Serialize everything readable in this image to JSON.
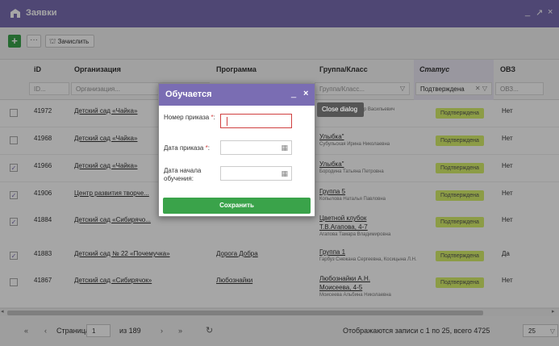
{
  "window": {
    "title": "Заявки",
    "icon": "building-icon",
    "controls": [
      "_",
      "↗",
      "×"
    ]
  },
  "toolbar": {
    "add_label": "+",
    "more_label": "···",
    "enroll_label": "Зачислить",
    "enroll_icon": "school-icon"
  },
  "columns": {
    "id": "iD",
    "org": "Организация",
    "program": "Программа",
    "group": "Группа/Класс",
    "status": "Статус",
    "ovz": "ОВЗ"
  },
  "filters": {
    "id": "ID...",
    "org": "Организация...",
    "group": "Группа/Класс...",
    "status": "Подтверждена",
    "ovz": "ОВЗ..."
  },
  "rows": [
    {
      "checked": false,
      "id": "41972",
      "org": "Детский сад «Чайка»",
      "program": "",
      "group": "",
      "group_sub": "Бадмаева Владимир Васильевич",
      "status": "Подтверждена",
      "ovz": "Нет"
    },
    {
      "checked": false,
      "id": "41968",
      "org": "Детский сад «Чайка»",
      "program": "",
      "group": "Улыбка\"",
      "group_sub": "Субульская Ирина Николаевна",
      "status": "Подтверждена",
      "ovz": "Нет"
    },
    {
      "checked": true,
      "id": "41966",
      "org": "Детский сад «Чайка»",
      "program": "",
      "group": "Улыбка\"",
      "group_sub": "Бородина Татьяна Петровна",
      "status": "Подтверждена",
      "ovz": "Нет"
    },
    {
      "checked": true,
      "id": "41906",
      "org": "Центр развития творче...",
      "program": "",
      "group": "Группа 5",
      "group_sub": "Копылова Наталья Павловна",
      "status": "Подтверждена",
      "ovz": "Нет"
    },
    {
      "checked": true,
      "id": "41884",
      "org": "Детский сад «Сибирячо...",
      "program": "",
      "group": "Цветной клубок",
      "group2": "Т.В.Агапова, 4-7",
      "group_sub": "Агапова Тамара Владимировна",
      "status": "Подтверждена",
      "ovz": "Нет"
    },
    {
      "checked": true,
      "id": "41883",
      "org": "Детский сад № 22 «Почемучка»",
      "program": "Дорога Добра",
      "group": "Группа 1",
      "group_sub": "Гарбуз Снежана Сергеевна, Косицына Л.Н.",
      "status": "Подтверждена",
      "ovz": "Да"
    },
    {
      "checked": false,
      "id": "41867",
      "org": "Детский сад «Сибирячок»",
      "program": "Любознайки",
      "group": "Любознайки А.Н.",
      "group2": "Моисеева, 4-5",
      "group_sub": "Моисеева Альбина Николаевна",
      "status": "Подтверждена",
      "ovz": "Нет"
    }
  ],
  "pager": {
    "first": "«",
    "prev": "‹",
    "page_label": "Страница",
    "page_value": "1",
    "of_label": "из 189",
    "next": "›",
    "last": "»",
    "refresh": "↻",
    "summary": "Отображаются записи с 1 по 25, всего 4725",
    "page_size": "25"
  },
  "dialog": {
    "title": "Обучается",
    "minimize": "_",
    "close": "×",
    "field1_label": "Номер приказа",
    "field2_label": "Дата приказа",
    "field3_label": "Дата начала обучения:",
    "required_mark": "*",
    "colon": ":",
    "save_label": "Сохранить"
  },
  "tooltip": {
    "text": "Close dialog"
  },
  "colors": {
    "accent": "#7a6db3",
    "green": "#3aa34a",
    "badge": "#d8f06c",
    "required": "#d04040"
  }
}
